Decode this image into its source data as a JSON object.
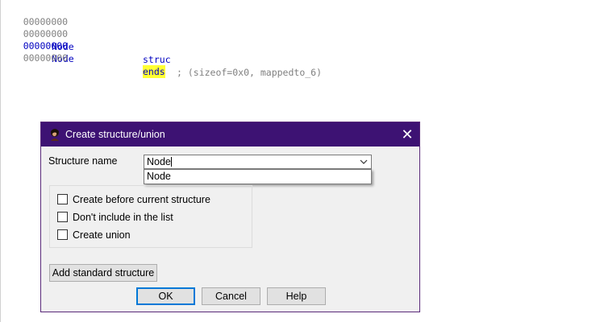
{
  "code": {
    "lines": [
      {
        "address": "00000000",
        "name": "",
        "keyword": "",
        "comment": ""
      },
      {
        "address": "00000000",
        "name": "Node",
        "keyword": "struc",
        "comment": "; (sizeof=0x0, mappedto_6)"
      },
      {
        "address": "00000000",
        "name": "Node",
        "keyword": "ends",
        "comment": ""
      },
      {
        "address": "00000000",
        "name": "",
        "keyword": "",
        "comment": ""
      }
    ]
  },
  "dialog": {
    "title": "Create structure/union",
    "close_glyph": "✕",
    "structure_name_label": "Structure name",
    "structure_name_value": "Node",
    "dropdown_option": "Node",
    "checkboxes": [
      {
        "label": "Create before current structure",
        "checked": false
      },
      {
        "label": "Don't include in the list",
        "checked": false
      },
      {
        "label": "Create union",
        "checked": false
      }
    ],
    "add_standard_label": "Add standard structure",
    "ok_label": "OK",
    "cancel_label": "Cancel",
    "help_label": "Help"
  },
  "colors": {
    "titlebar": "#3d1273",
    "code_name": "#0000c0",
    "code_address": "#808080",
    "highlight": "#ffff33"
  }
}
